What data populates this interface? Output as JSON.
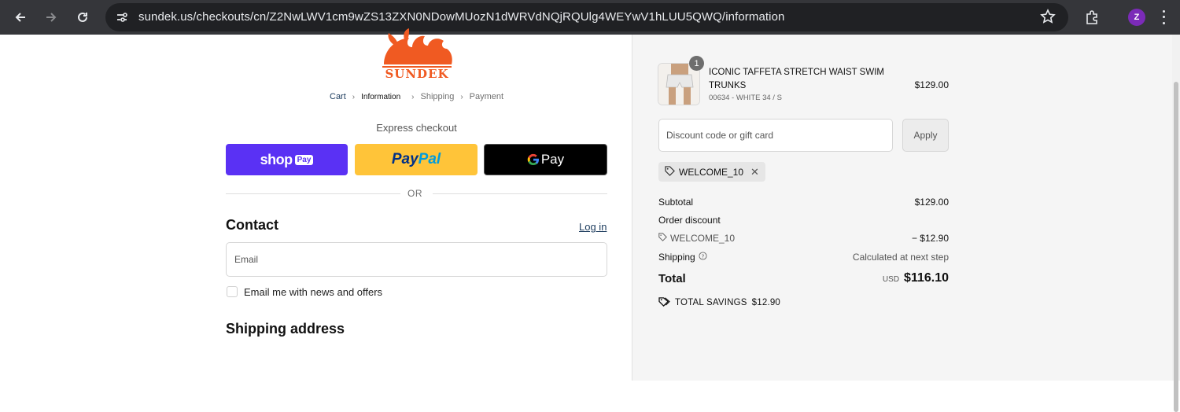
{
  "browser": {
    "url": "sundek.us/checkouts/cn/Z2NwLWV1cm9wZS13ZXN0NDowMUozN1dWRVdNQjRQUlg4WEYwV1hLUU5QWQ/information",
    "profile_initial": "Z"
  },
  "logo": {
    "brand": "SUNDEK",
    "color": "#f05a22"
  },
  "breadcrumb": {
    "cart": "Cart",
    "information": "Information",
    "shipping": "Shipping",
    "payment": "Payment"
  },
  "express": {
    "title": "Express checkout",
    "shop_label": "shop",
    "shop_pay_badge": "Pay",
    "paypal_label_1": "Pay",
    "paypal_label_2": "Pal",
    "gpay_label": "Pay"
  },
  "or_text": "OR",
  "contact": {
    "heading": "Contact",
    "login": "Log in",
    "email_placeholder": "Email",
    "newsletter_label": "Email me with news and offers"
  },
  "shipping_heading": "Shipping address",
  "summary": {
    "product": {
      "quantity": "1",
      "name": "ICONIC TAFFETA STRETCH WAIST SWIM TRUNKS",
      "variant": "00634 - WHITE 34 / S",
      "price": "$129.00"
    },
    "discount_placeholder": "Discount code or gift card",
    "apply_label": "Apply",
    "applied_code": "WELCOME_10",
    "subtotal_label": "Subtotal",
    "subtotal_value": "$129.00",
    "order_discount_label": "Order discount",
    "discount_code": "WELCOME_10",
    "discount_value": "− $12.90",
    "shipping_label": "Shipping",
    "shipping_value": "Calculated at next step",
    "total_label": "Total",
    "total_currency": "USD",
    "total_value": "$116.10",
    "savings_label": "TOTAL SAVINGS",
    "savings_value": "$12.90"
  },
  "colors": {
    "shop_pay": "#5a31f4",
    "paypal": "#ffc439",
    "gpay": "#000000",
    "brand_orange": "#f05a22"
  }
}
